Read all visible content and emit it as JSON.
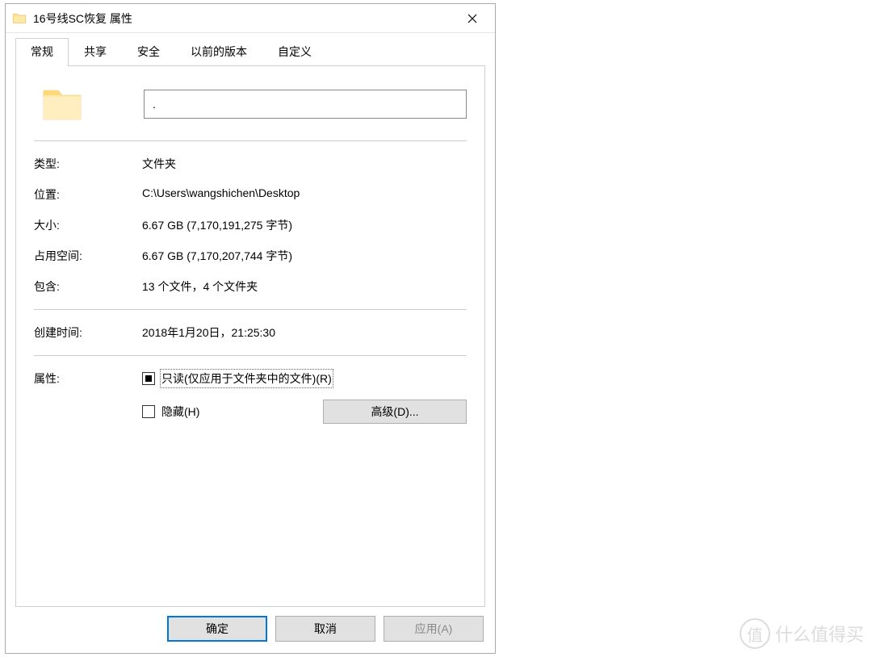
{
  "window": {
    "title": "16号线SC恢复 属性"
  },
  "tabs": {
    "general": "常规",
    "share": "共享",
    "security": "安全",
    "previous": "以前的版本",
    "custom": "自定义"
  },
  "name_input_value": ".",
  "props": {
    "type_label": "类型:",
    "type_value": "文件夹",
    "location_label": "位置:",
    "location_value": "C:\\Users\\wangshichen\\Desktop",
    "size_label": "大小:",
    "size_value": "6.67 GB (7,170,191,275 字节)",
    "sizeon_label": "占用空间:",
    "sizeon_value": "6.67 GB (7,170,207,744 字节)",
    "contains_label": "包含:",
    "contains_value": "13 个文件，4 个文件夹",
    "created_label": "创建时间:",
    "created_value": "2018年1月20日，21:25:30",
    "attr_label": "属性:",
    "readonly_label": "只读(仅应用于文件夹中的文件)(R)",
    "hidden_label": "隐藏(H)",
    "advanced_button": "高级(D)..."
  },
  "buttons": {
    "ok": "确定",
    "cancel": "取消",
    "apply": "应用(A)"
  },
  "watermark": {
    "badge": "值",
    "text": "什么值得买"
  }
}
